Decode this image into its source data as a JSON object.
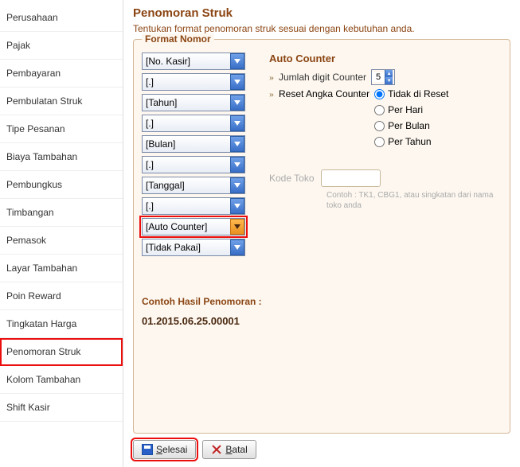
{
  "sidebar": {
    "items": [
      {
        "label": "Perusahaan"
      },
      {
        "label": "Pajak"
      },
      {
        "label": "Pembayaran"
      },
      {
        "label": "Pembulatan Struk"
      },
      {
        "label": "Tipe Pesanan"
      },
      {
        "label": "Biaya Tambahan"
      },
      {
        "label": "Pembungkus"
      },
      {
        "label": "Timbangan"
      },
      {
        "label": "Pemasok"
      },
      {
        "label": "Layar Tambahan"
      },
      {
        "label": "Poin Reward"
      },
      {
        "label": "Tingkatan Harga"
      },
      {
        "label": "Penomoran Struk"
      },
      {
        "label": "Kolom Tambahan"
      },
      {
        "label": "Shift Kasir"
      }
    ]
  },
  "page": {
    "title": "Penomoran Struk",
    "description": "Tentukan format penomoran struk sesuai dengan kebutuhan anda."
  },
  "panel": {
    "title": "Format Nomor",
    "selects": [
      {
        "value": "[No. Kasir]"
      },
      {
        "value": "[.]"
      },
      {
        "value": "[Tahun]"
      },
      {
        "value": "[.]"
      },
      {
        "value": "[Bulan]"
      },
      {
        "value": "[.]"
      },
      {
        "value": "[Tanggal]"
      },
      {
        "value": "[.]"
      },
      {
        "value": "[Auto Counter]"
      },
      {
        "value": "[Tidak Pakai]"
      }
    ],
    "autoCounter": {
      "title": "Auto Counter",
      "digitLabel": "Jumlah digit Counter",
      "digitValue": "5",
      "resetLabel": "Reset Angka Counter",
      "radios": [
        {
          "label": "Tidak di Reset"
        },
        {
          "label": "Per Hari"
        },
        {
          "label": "Per Bulan"
        },
        {
          "label": "Per Tahun"
        }
      ]
    },
    "kodeToko": {
      "label": "Kode Toko",
      "hint": "Contoh :  TK1, CBG1, atau singkatan dari nama toko anda"
    },
    "example": {
      "label": "Contoh Hasil Penomoran :",
      "value": "01.2015.06.25.00001"
    }
  },
  "footer": {
    "save": "elesai",
    "savePrefix": "S",
    "cancel": "atal",
    "cancelPrefix": "B"
  }
}
